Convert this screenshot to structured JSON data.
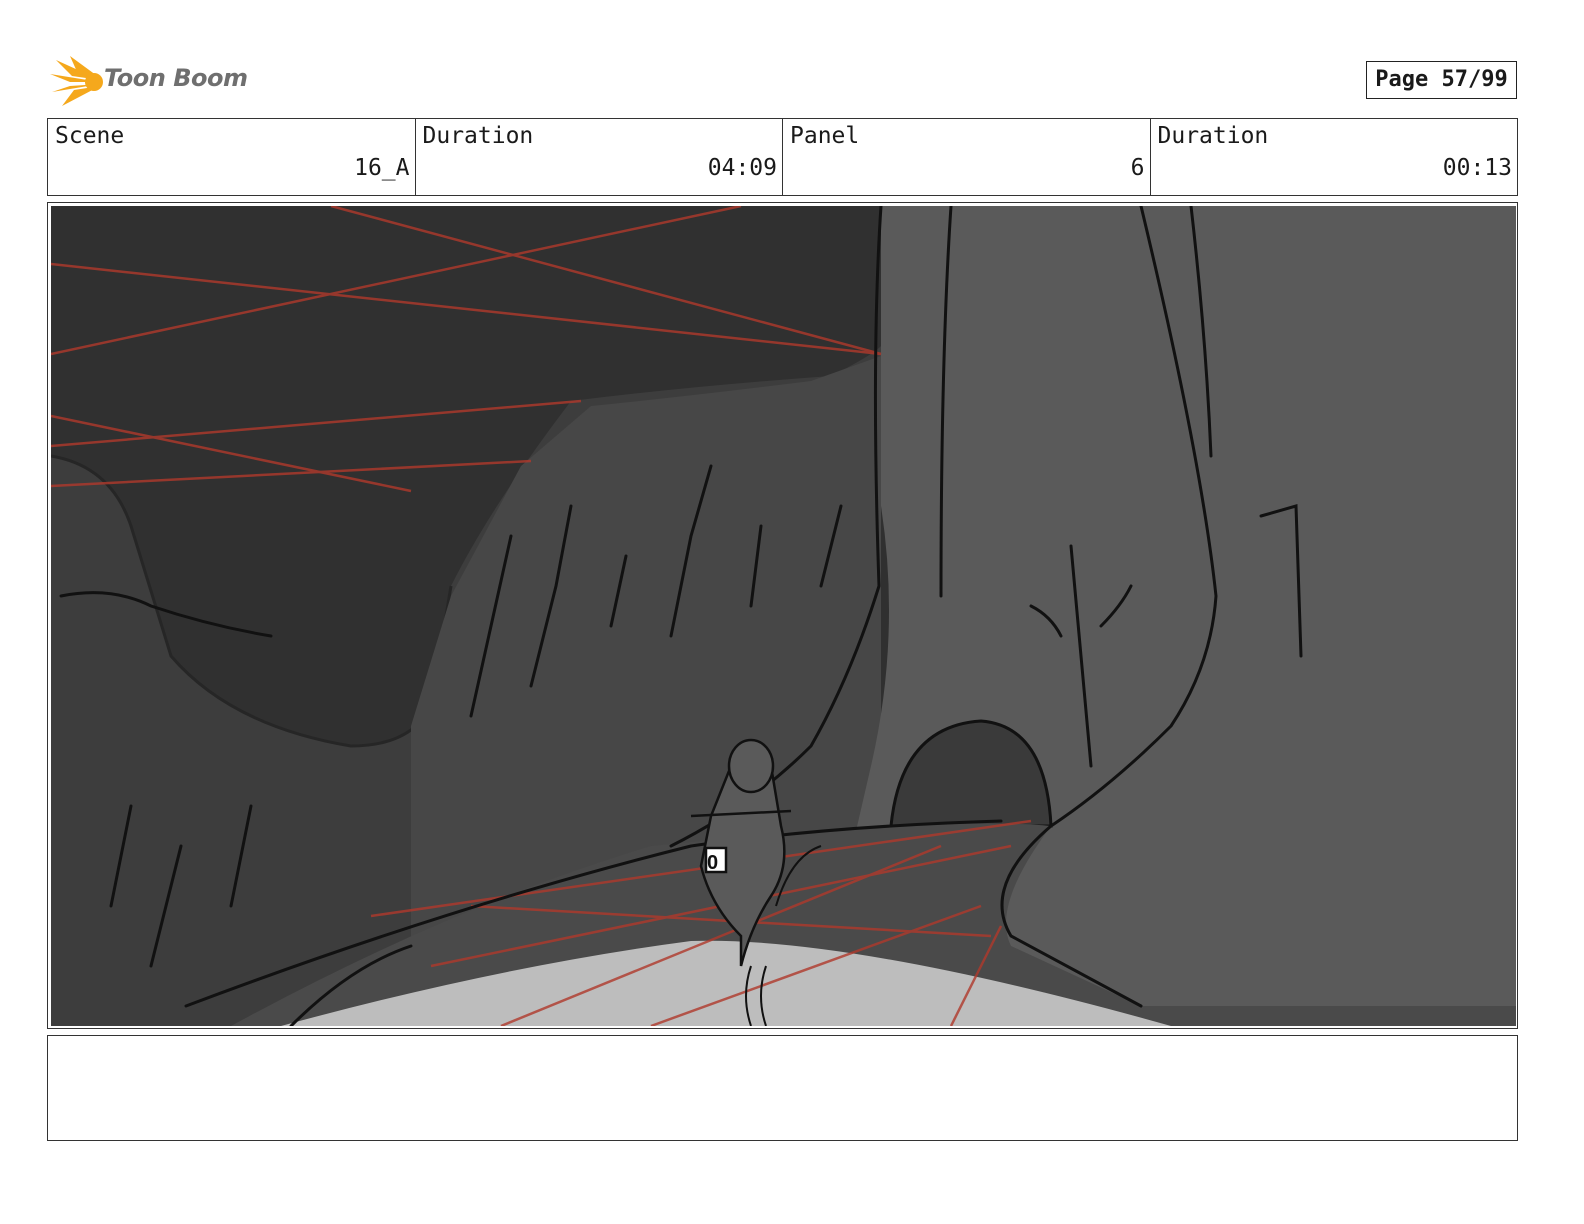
{
  "header": {
    "logo_text": "Toon Boom",
    "page_label": "Page 57/99"
  },
  "info": {
    "scene_label": "Scene",
    "scene_value": "16_A",
    "scene_duration_label": "Duration",
    "scene_duration_value": "04:09",
    "panel_label": "Panel",
    "panel_value": "6",
    "panel_duration_label": "Duration",
    "panel_duration_value": "00:13"
  },
  "panel": {
    "bike_number": "0"
  },
  "notes": {
    "text": ""
  },
  "colors": {
    "logo_orange": "#f5a81c",
    "perspective_red": "#b0392c",
    "sky": "#303030",
    "cliff_right": "#5a5a5a",
    "road_light": "#bdbdbd"
  }
}
